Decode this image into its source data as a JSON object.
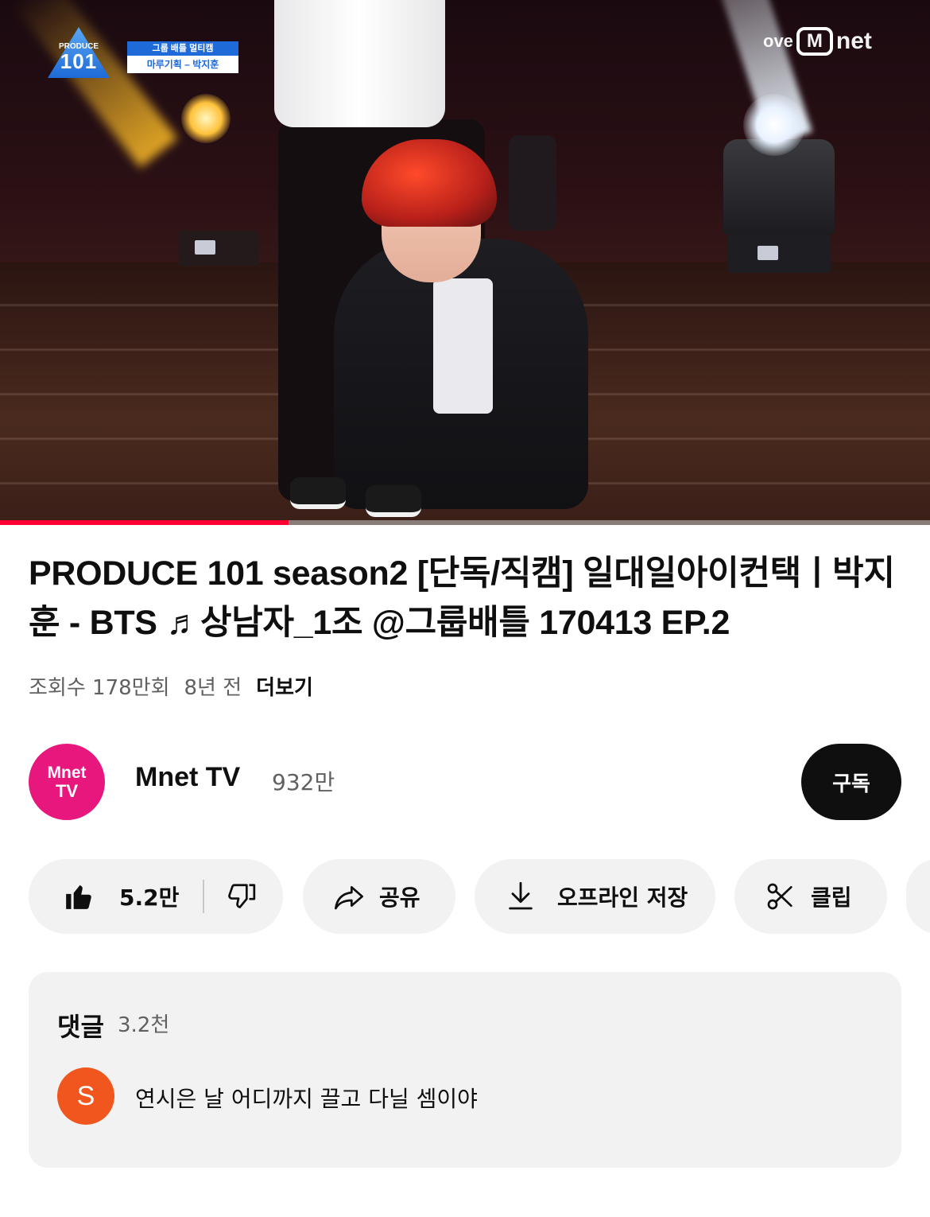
{
  "video": {
    "overlay_program_logo": {
      "line1": "PRODUCE",
      "line2": "101"
    },
    "overlay_banner": {
      "line1": "그룹 배틀 멀티캠",
      "line2": "마루기획 – 박지훈"
    },
    "broadcast_logo": {
      "prefix": "ove",
      "m": "M",
      "suffix": "net"
    },
    "progress_fraction": 0.31
  },
  "title": "PRODUCE 101 season2 [단독/직캠] 일대일아이컨택ㅣ박지훈 - BTS ♬상남자_1조 @그룹배틀 170413 EP.2",
  "meta": {
    "views": "조회수 178만회",
    "age": "8년 전",
    "more": "더보기"
  },
  "channel": {
    "avatar_line1": "Mnet",
    "avatar_line2": "TV",
    "name": "Mnet TV",
    "subscribers": "932만",
    "subscribe_label": "구독"
  },
  "actions": {
    "likes": "5.2만",
    "share": "공유",
    "download": "오프라인 저장",
    "clip": "클립"
  },
  "comments": {
    "title": "댓글",
    "count": "3.2천",
    "top_comment": {
      "avatar_letter": "S",
      "text": "연시은 날 어디까지 끌고 다닐 셈이야"
    }
  },
  "colors": {
    "accent_red": "#ff0033",
    "mnet_pink": "#e8177e",
    "commenter_orange": "#f0561e"
  }
}
